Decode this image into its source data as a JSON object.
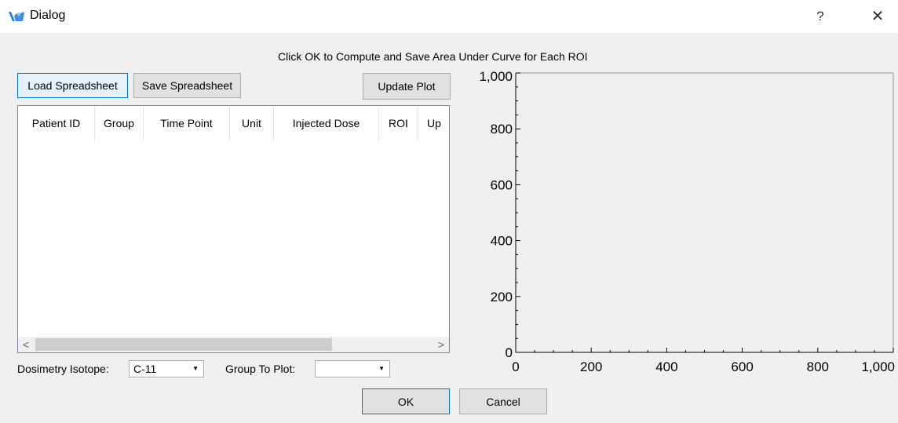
{
  "window": {
    "title": "Dialog",
    "help_glyph": "?",
    "close_glyph": "✕",
    "icon": "app-logo-icon"
  },
  "instruction": "Click OK to Compute and Save Area Under Curve for Each ROI",
  "toolbar": {
    "load_label": "Load Spreadsheet",
    "save_label": "Save Spreadsheet",
    "update_label": "Update Plot"
  },
  "table": {
    "columns": [
      "Patient ID",
      "Group",
      "Time Point",
      "Unit",
      "Injected Dose",
      "ROI",
      "Up"
    ],
    "rows": [],
    "scroll_left_glyph": "<",
    "scroll_right_glyph": ">"
  },
  "controls": {
    "isotope_label": "Dosimetry Isotope:",
    "isotope_value": "C-11",
    "group_label": "Group To Plot:",
    "group_value": "",
    "dropdown_glyph": "▼"
  },
  "buttons": {
    "ok_label": "OK",
    "cancel_label": "Cancel"
  },
  "chart_data": {
    "type": "scatter",
    "series": [],
    "xlim": [
      0,
      1000
    ],
    "ylim": [
      0,
      1000
    ],
    "xticks": [
      0,
      200,
      400,
      600,
      800,
      1000
    ],
    "yticks": [
      0,
      200,
      400,
      600,
      800,
      1000
    ],
    "xtick_labels": [
      "0",
      "200",
      "400",
      "600",
      "800",
      "1,000"
    ],
    "ytick_labels": [
      "0",
      "200",
      "400",
      "600",
      "800",
      "1,000"
    ],
    "title": "",
    "xlabel": "",
    "ylabel": "",
    "grid": false,
    "plot_background": "#f0f0f0"
  }
}
